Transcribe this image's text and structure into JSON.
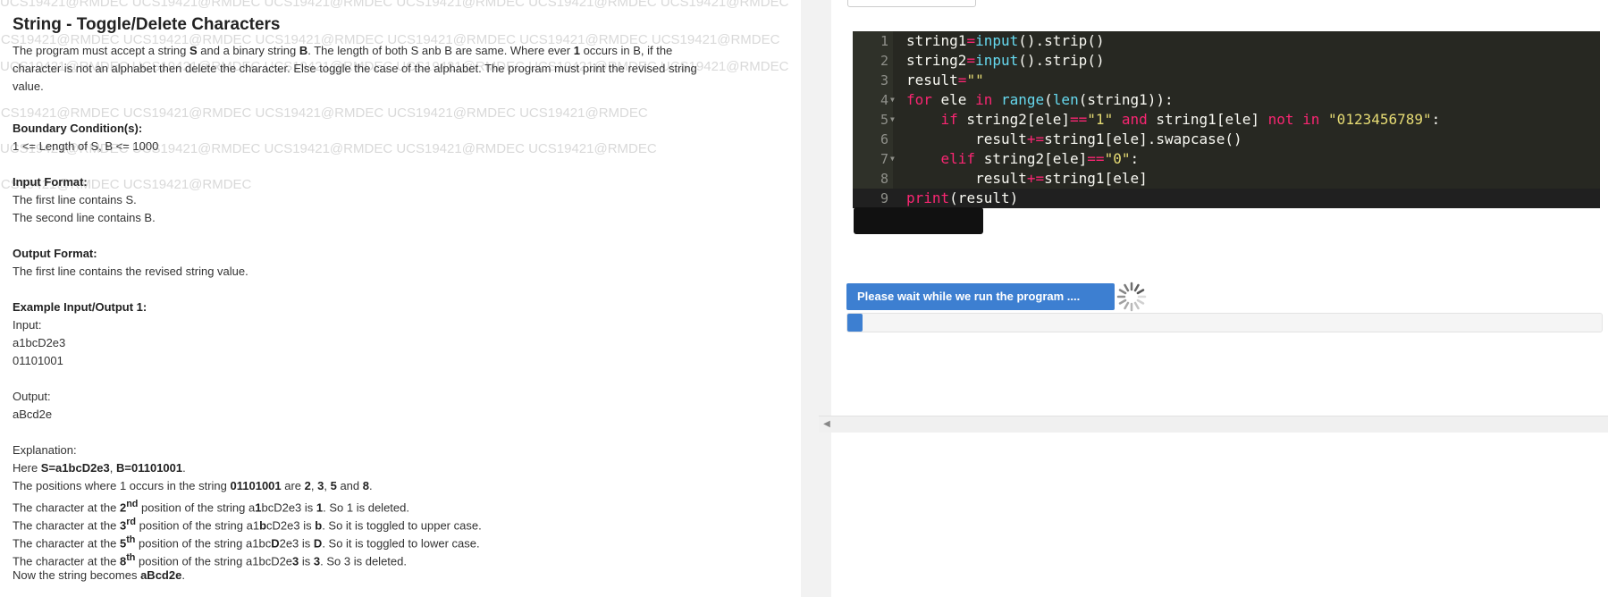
{
  "watermark": {
    "text": "UCS19421@RMDEC",
    "color": "#d9d9d9"
  },
  "problem": {
    "title": "String - Toggle/Delete Characters",
    "description_parts": {
      "p1": "The program must accept a string ",
      "s": "S",
      "p2": " and a binary string ",
      "b": "B",
      "p3": ". The length of both S anb B are same. Where ever ",
      "one": "1",
      "p4": " occurs in B, if the",
      "p5": "character is not an alphabet then delete the character. Else toggle the case of the alphabet. The program must print the revised string",
      "p6": "value."
    },
    "boundary_heading": "Boundary Condition(s):",
    "boundary_text": "1 <= Length of S, B <= 1000",
    "input_heading": "Input Format:",
    "input_line1": "The first line contains S.",
    "input_line2": "The second line contains B.",
    "output_heading": "Output Format:",
    "output_text": "The first line contains the revised string value.",
    "example_heading": "Example Input/Output 1:",
    "example_input_label": "Input:",
    "example_input_1": "a1bcD2e3",
    "example_input_2": "01101001",
    "example_output_label": "Output:",
    "example_output": "aBcd2e",
    "explanation_label": "Explanation:",
    "exp_here": "Here ",
    "exp_s": "S=a1bcD2e3",
    "exp_comma": ", ",
    "exp_b": "B=01101001",
    "exp_dot": ".",
    "exp_pos_1": "The positions where 1 occurs in the string ",
    "exp_pos_str": "01101001",
    "exp_pos_2": " are ",
    "exp_pos_2v": "2",
    "exp_pos_sep1": ", ",
    "exp_pos_3v": "3",
    "exp_pos_sep2": ", ",
    "exp_pos_5v": "5",
    "exp_pos_and": " and ",
    "exp_pos_8v": "8",
    "exp_pos_end": ".",
    "char_prefix": "The character at the ",
    "pos_mid": " position of the string ",
    "l1_num": "2",
    "l1_sup": "nd",
    "l1_s1": "a",
    "l1_hl": "1",
    "l1_s2": "bcD2e3",
    "l1_is": " is ",
    "l1_val": "1",
    "l1_end": ". So 1 is deleted.",
    "l2_num": "3",
    "l2_sup": "rd",
    "l2_s1": "a1",
    "l2_hl": "b",
    "l2_s2": "cD2e3",
    "l2_is": " is ",
    "l2_val": "b",
    "l2_end": ". So it is toggled to upper case.",
    "l3_num": "5",
    "l3_sup": "th",
    "l3_s1": "a1bc",
    "l3_hl": "D",
    "l3_s2": "2e3",
    "l3_is": " is ",
    "l3_val": "D",
    "l3_end": ". So it is toggled to lower case.",
    "l4_num": "8",
    "l4_sup": "th",
    "l4_s1": "a1bcD2e",
    "l4_hl": "3",
    "l4_s2": "",
    "l4_is": " is ",
    "l4_val": "3",
    "l4_end": ". So 3 is deleted.",
    "final_1": "Now the string becomes ",
    "final_val": "aBcd2e",
    "final_end": "."
  },
  "editor": {
    "line_numbers": [
      "1",
      "2",
      "3",
      "4",
      "5",
      "6",
      "7",
      "8",
      "9"
    ],
    "theme_background": "#272822"
  },
  "run": {
    "button_label": "Please wait while we run the program ....",
    "progress_fraction": 0.02,
    "accent": "#3d7fd1"
  }
}
